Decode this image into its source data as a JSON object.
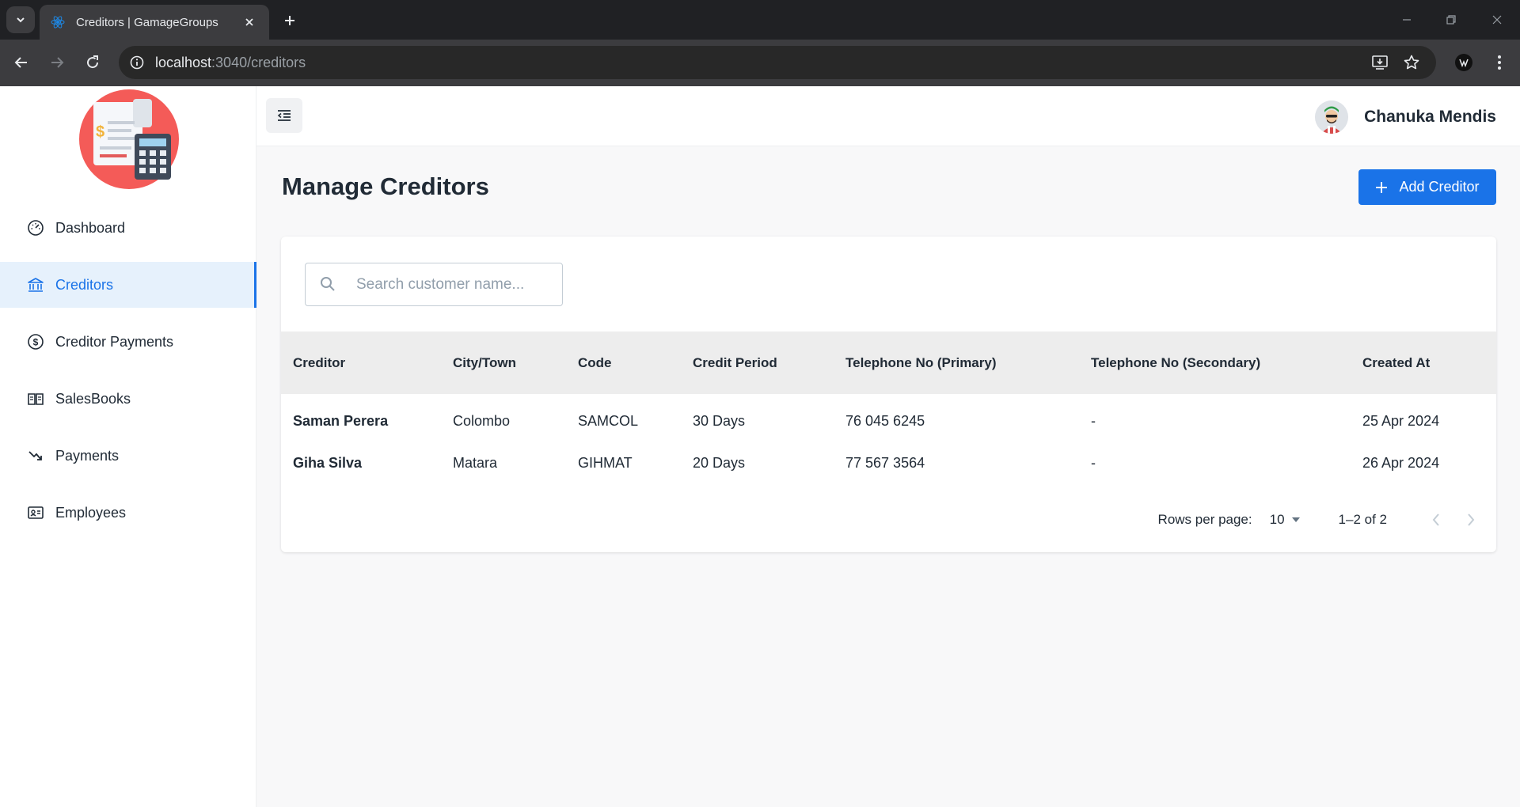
{
  "browser": {
    "tab_title": "Creditors | GamageGroups",
    "url_host": "localhost",
    "url_rest": ":3040/creditors"
  },
  "sidebar": {
    "items": [
      {
        "label": "Dashboard",
        "icon": "dashboard-gauge-icon",
        "active": false
      },
      {
        "label": "Creditors",
        "icon": "bank-icon",
        "active": true
      },
      {
        "label": "Creditor Payments",
        "icon": "dollar-circle-icon",
        "active": false
      },
      {
        "label": "SalesBooks",
        "icon": "book-icon",
        "active": false
      },
      {
        "label": "Payments",
        "icon": "trending-down-icon",
        "active": false
      },
      {
        "label": "Employees",
        "icon": "id-card-icon",
        "active": false
      }
    ]
  },
  "header": {
    "user_name": "Chanuka Mendis"
  },
  "main": {
    "title": "Manage Creditors",
    "add_button_label": "Add Creditor",
    "search_placeholder": "Search customer name..."
  },
  "table": {
    "columns": [
      "Creditor",
      "City/Town",
      "Code",
      "Credit Period",
      "Telephone No (Primary)",
      "Telephone No (Secondary)",
      "Created At"
    ],
    "rows": [
      {
        "creditor": "Saman Perera",
        "city": "Colombo",
        "code": "SAMCOL",
        "credit_period": "30 Days",
        "tel_primary": "76 045 6245",
        "tel_secondary": "-",
        "created_at": "25 Apr 2024"
      },
      {
        "creditor": "Giha Silva",
        "city": "Matara",
        "code": "GIHMAT",
        "credit_period": "20 Days",
        "tel_primary": "77 567 3564",
        "tel_secondary": "-",
        "created_at": "26 Apr 2024"
      }
    ]
  },
  "pagination": {
    "rows_per_page_label": "Rows per page:",
    "rows_per_page_value": "10",
    "range": "1–2 of 2"
  },
  "colors": {
    "accent": "#1a73e8",
    "active_bg": "#e6f1fc",
    "table_header_bg": "#ededed"
  }
}
